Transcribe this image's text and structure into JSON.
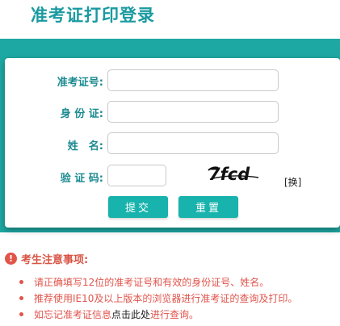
{
  "page": {
    "title": "准考证打印登录"
  },
  "form": {
    "ticket_number_label": "准考证号:",
    "ticket_number_value": "",
    "id_card_label": "身 份 证:",
    "id_card_value": "",
    "name_label": "姓　名:",
    "name_value": "",
    "captcha_label": "验 证 码:",
    "captcha_value": "",
    "captcha_text": "7fcd",
    "refresh_label": "[换]",
    "submit_label": "提交",
    "reset_label": "重置"
  },
  "notice": {
    "icon": "!",
    "title": "考生注意事项:",
    "item1": "请正确填写12位的准考证号和有效的身份证号、姓名。",
    "item2": "推荐使用IE10及以上版本的浏览器进行准考证的查询及打印。",
    "item3_before": "如忘记准考证信息",
    "item3_link": "点击此处",
    "item3_after": "进行查询。"
  },
  "colors": {
    "accent": "#1ea8a3",
    "title": "#1a9aa0",
    "label": "#1a8a90",
    "warning": "#e0544b"
  },
  "icons": [
    "warning-icon",
    "bullet-icon"
  ]
}
